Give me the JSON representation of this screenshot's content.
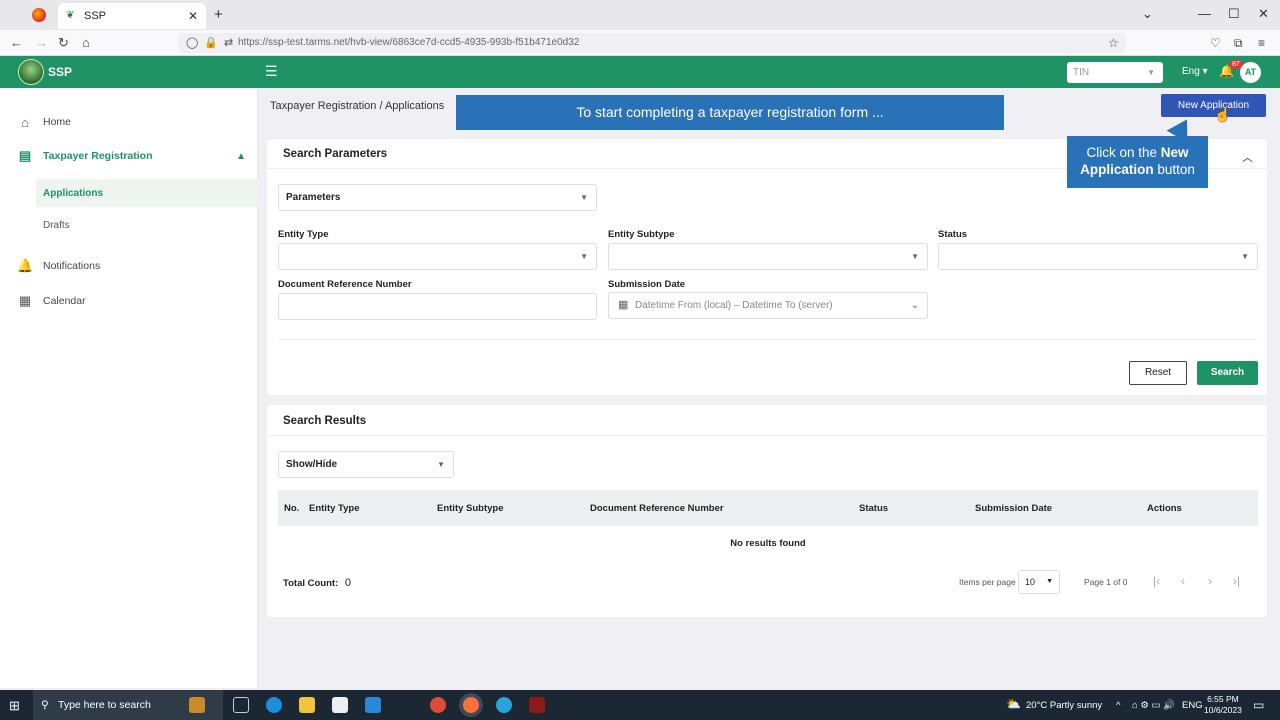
{
  "browser": {
    "tab_title": "SSP",
    "url": "https://ssp-test.tarms.net/hvb-view/6863ce7d-ccd5-4935-993b-f51b471e0d32"
  },
  "app": {
    "brand": "SSP",
    "tin_placeholder": "TIN",
    "language": "Eng",
    "notification_count": "87",
    "avatar_initials": "AT",
    "accent_color": "#1f9266"
  },
  "sidebar": {
    "items": [
      {
        "label": "Home",
        "icon": "home-icon"
      },
      {
        "label": "Taxpayer Registration",
        "icon": "id-card-icon"
      },
      {
        "label": "Notifications",
        "icon": "bell-icon"
      },
      {
        "label": "Calendar",
        "icon": "calendar-icon"
      }
    ],
    "sub_items": [
      {
        "label": "Applications"
      },
      {
        "label": "Drafts"
      }
    ]
  },
  "main": {
    "breadcrumb": "Taxpayer Registration / Applications",
    "new_application_label": "New Application"
  },
  "tutorial": {
    "banner_text": "To start completing a taxpayer registration form ...",
    "callout_prefix": "Click on the ",
    "callout_bold": "New Application",
    "callout_suffix": " button"
  },
  "search_params": {
    "title": "Search Parameters",
    "parameters_select": "Parameters",
    "entity_type_label": "Entity Type",
    "entity_subtype_label": "Entity Subtype",
    "status_label": "Status",
    "doc_ref_label": "Document Reference Number",
    "submission_date_label": "Submission Date",
    "date_placeholder": "Datetime From (local) – Datetime To (server)",
    "reset_label": "Reset",
    "search_label": "Search"
  },
  "results": {
    "title": "Search Results",
    "show_hide": "Show/Hide",
    "columns": [
      "No.",
      "Entity Type",
      "Entity Subtype",
      "Document Reference Number",
      "Status",
      "Submission Date",
      "Actions"
    ],
    "empty_text": "No results found",
    "total_label": "Total Count:",
    "total_value": "0",
    "items_per_page_label": "Items per page",
    "items_per_page": "10",
    "page_info": "Page 1 of 0"
  },
  "taskbar": {
    "search_placeholder": "Type here to search",
    "weather": "20°C  Partly sunny",
    "lang": "ENG",
    "time": "6:55 PM",
    "date": "10/6/2023"
  }
}
